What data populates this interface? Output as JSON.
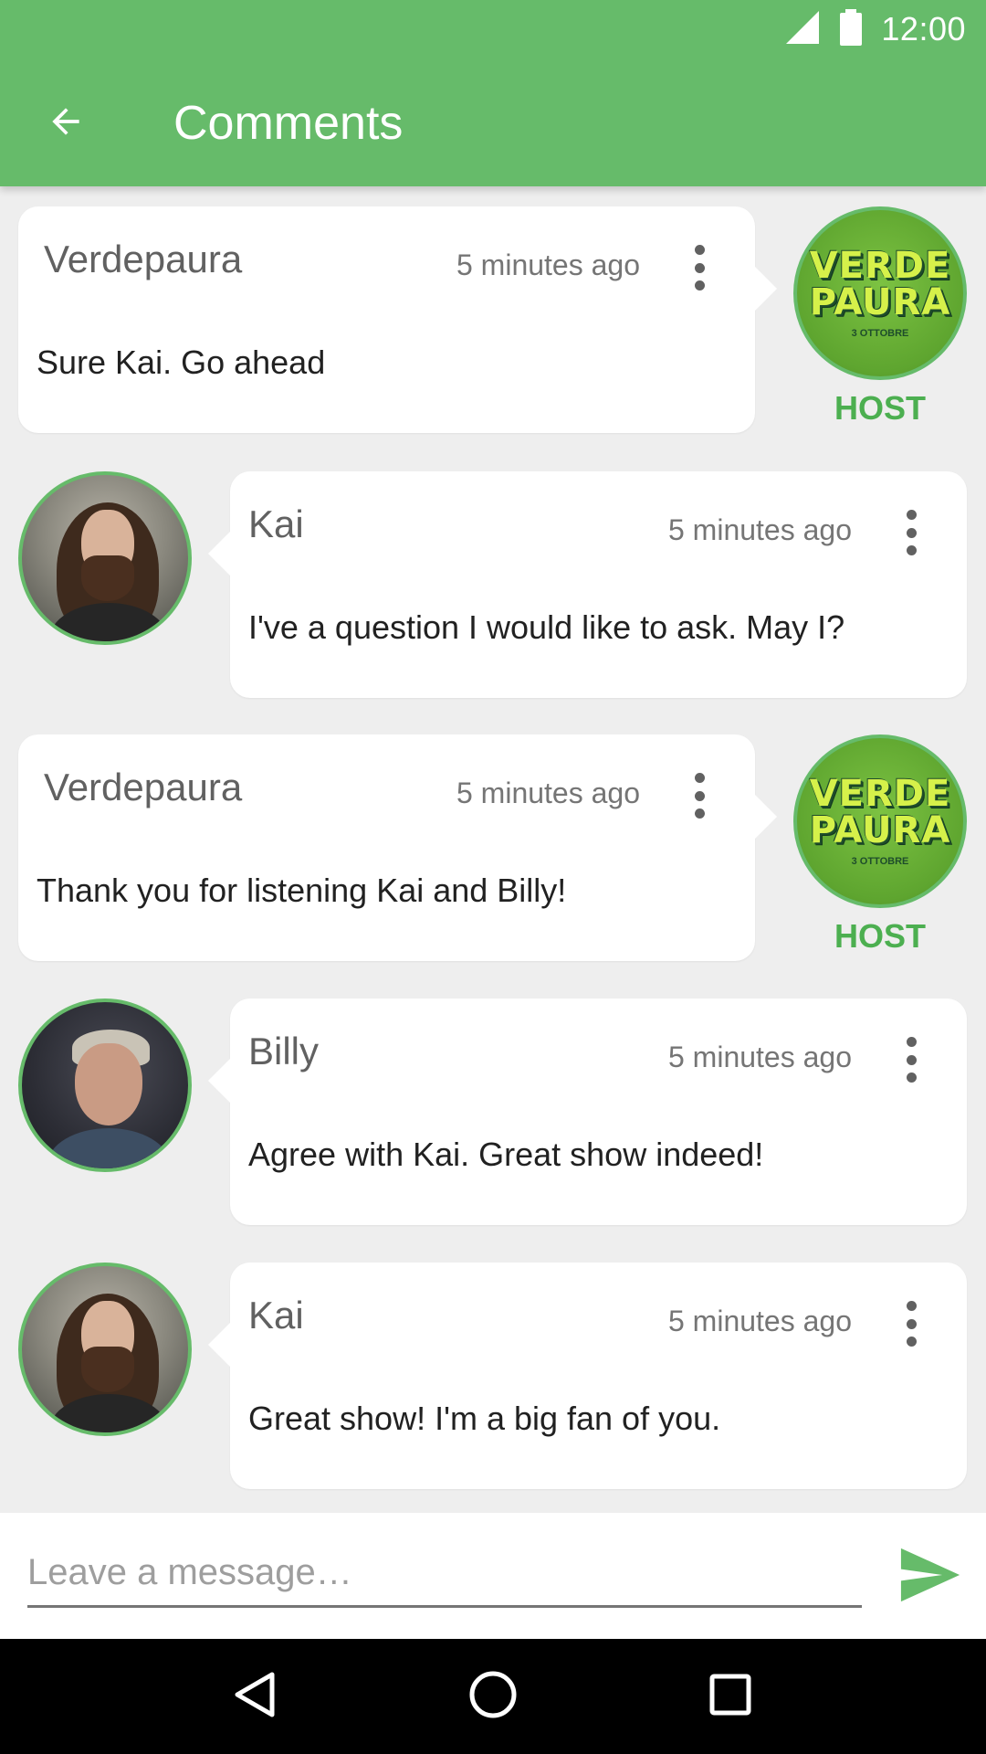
{
  "status_bar": {
    "time": "12:00",
    "icons": [
      "signal-icon",
      "battery-icon"
    ]
  },
  "app_bar": {
    "title": "Comments",
    "back_icon": "arrow-back-icon",
    "color": "#66bb6a"
  },
  "comments": [
    {
      "author": "Verdepaura",
      "time": "5 minutes ago",
      "message": "Sure Kai. Go ahead",
      "role": "host",
      "badge": "HOST",
      "logo": {
        "line1": "VERDE",
        "line2": "PAURA",
        "sub": "3 OTTOBRE"
      }
    },
    {
      "author": "Kai",
      "time": "5 minutes ago",
      "message": "I've a question I would like to ask. May I?",
      "role": "guest"
    },
    {
      "author": "Verdepaura",
      "time": "5 minutes ago",
      "message": "Thank you for listening Kai and Billy!",
      "role": "host",
      "badge": "HOST",
      "logo": {
        "line1": "VERDE",
        "line2": "PAURA",
        "sub": "3 OTTOBRE"
      }
    },
    {
      "author": "Billy",
      "time": "5 minutes ago",
      "message": "Agree with Kai. Great show indeed!",
      "role": "guest"
    },
    {
      "author": "Kai",
      "time": "5 minutes ago",
      "message": "Great show! I'm a big fan of you.",
      "role": "guest"
    }
  ],
  "input": {
    "placeholder": "Leave a message…",
    "value": "",
    "send_icon": "send-icon"
  },
  "nav_bar": {
    "icons": [
      "nav-back-icon",
      "nav-home-icon",
      "nav-recents-icon"
    ]
  },
  "colors": {
    "accent": "#66bb6a",
    "badge": "#4caf50",
    "background": "#eeeeee"
  }
}
